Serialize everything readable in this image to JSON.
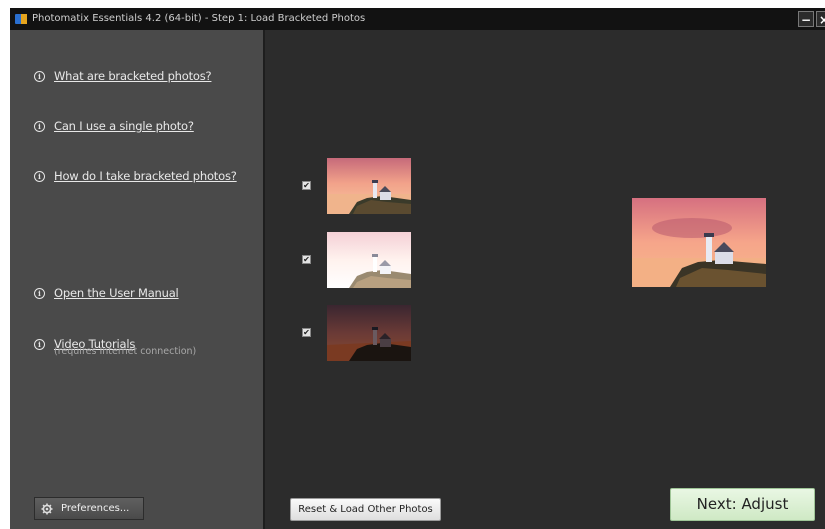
{
  "window": {
    "title": "Photomatix Essentials  4.2 (64-bit) - Step 1: Load Bracketed Photos",
    "minimize_glyph": "−",
    "close_glyph": "×"
  },
  "sidebar": {
    "help_links": [
      {
        "label": "What are bracketed photos?",
        "icon": "info-icon"
      },
      {
        "label": "Can I use a single photo?",
        "icon": "info-icon"
      },
      {
        "label": "How do I take bracketed photos?",
        "icon": "info-icon"
      },
      {
        "label": "Open the User Manual",
        "icon": "info-icon"
      },
      {
        "label": "Video Tutorials",
        "icon": "info-icon"
      }
    ],
    "video_note": "(requires Internet connection)",
    "preferences_label": "Preferences...",
    "info_glyph": "i"
  },
  "bracketed_photos": [
    {
      "checked": true,
      "exposure": "normal"
    },
    {
      "checked": true,
      "exposure": "over"
    },
    {
      "checked": true,
      "exposure": "under"
    }
  ],
  "buttons": {
    "reset_label": "Reset & Load Other Photos",
    "next_label": "Next: Adjust"
  },
  "colors": {
    "sidebar_bg": "#4a4a4a",
    "main_bg": "#2c2c2c",
    "next_button": "#d9f0d2"
  }
}
